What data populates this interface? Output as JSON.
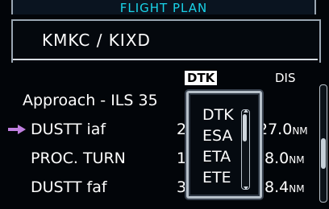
{
  "header": {
    "title": "FLIGHT PLAN"
  },
  "route": {
    "text": "KMKC / KIXD"
  },
  "columns": {
    "dtk": "DTK",
    "dis": "DIS"
  },
  "approach": {
    "label": "Approach - ILS 35"
  },
  "rows": [
    {
      "name": "DUSTT iaf",
      "dtk_digit": "2",
      "dis": "27.0",
      "unit": "NM",
      "active": true
    },
    {
      "name": "PROC. TURN",
      "dtk_digit": "1",
      "dis": "8.0",
      "unit": "NM",
      "active": false
    },
    {
      "name": "DUSTT faf",
      "dtk_digit": "3",
      "dis": "8.4",
      "unit": "NM",
      "active": false
    }
  ],
  "popup": {
    "options": [
      "DTK",
      "ESA",
      "ETA",
      "ETE"
    ]
  },
  "colors": {
    "cyan": "#19d3e8",
    "magenta": "#c080e0"
  },
  "icons": {
    "active_leg": "right-arrow-icon"
  }
}
